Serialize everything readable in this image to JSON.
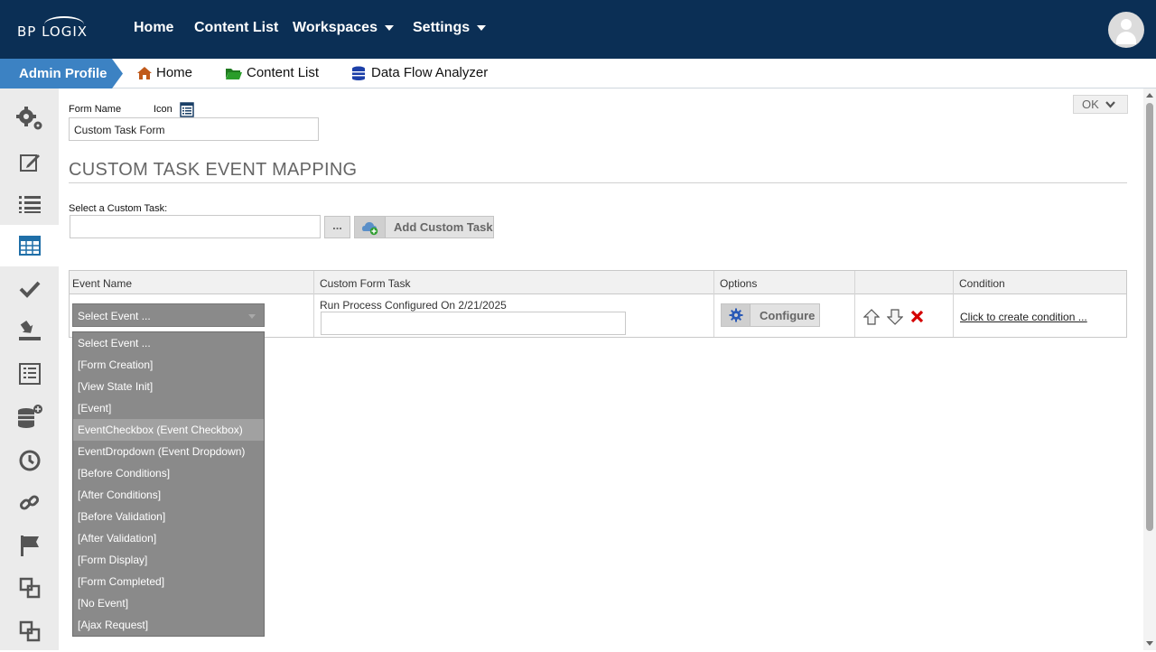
{
  "app": {
    "logo_text": "BP LOGIX"
  },
  "topnav": {
    "items": [
      {
        "label": "Home"
      },
      {
        "label": "Content List"
      },
      {
        "label": "Workspaces"
      },
      {
        "label": "Settings"
      }
    ]
  },
  "breadcrumb": {
    "active": "Admin Profile",
    "items": [
      {
        "label": "Home",
        "icon": "home-icon"
      },
      {
        "label": "Content List",
        "icon": "folder-icon"
      },
      {
        "label": "Data Flow Analyzer",
        "icon": "database-icon"
      }
    ]
  },
  "sidebar": {
    "icons": [
      "gears-icon",
      "edit-icon",
      "list-icon",
      "table-icon",
      "check-icon",
      "download-tray-icon",
      "form-list-icon",
      "database-add-icon",
      "timer-icon",
      "link-icon",
      "flag-icon",
      "copy-icon",
      "clone-icon"
    ],
    "active_index": 3
  },
  "form": {
    "name_label": "Form Name",
    "icon_label": "Icon",
    "name_value": "Custom Task Form"
  },
  "ok_button": {
    "label": "OK"
  },
  "section": {
    "title": "CUSTOM TASK EVENT MAPPING"
  },
  "custom_task": {
    "label": "Select a Custom Task:",
    "value": "",
    "browse_label": "...",
    "add_label": "Add Custom Task"
  },
  "grid": {
    "headers": [
      "Event Name",
      "Custom Form Task",
      "Options",
      "",
      "Condition"
    ],
    "row": {
      "event_selected": "Select Event ...",
      "task_text": "Run Process Configured On 2/21/2025",
      "configure_label": "Configure",
      "condition_link": "Click to create condition ..."
    }
  },
  "event_dropdown": {
    "highlighted_index": 4,
    "options": [
      "Select Event ...",
      "[Form Creation]",
      "[View State Init]",
      "[Event]",
      "EventCheckbox (Event Checkbox)",
      "EventDropdown (Event Dropdown)",
      "[Before Conditions]",
      "[After Conditions]",
      "[Before Validation]",
      "[After Validation]",
      "[Form Display]",
      "[Form Completed]",
      "[No Event]",
      "[Ajax Request]"
    ]
  },
  "colors": {
    "topnav_bg": "#0b2f55",
    "admin_tab": "#3c82c3",
    "dropdown_bg": "#8a8a8a",
    "delete_red": "#d40000"
  }
}
